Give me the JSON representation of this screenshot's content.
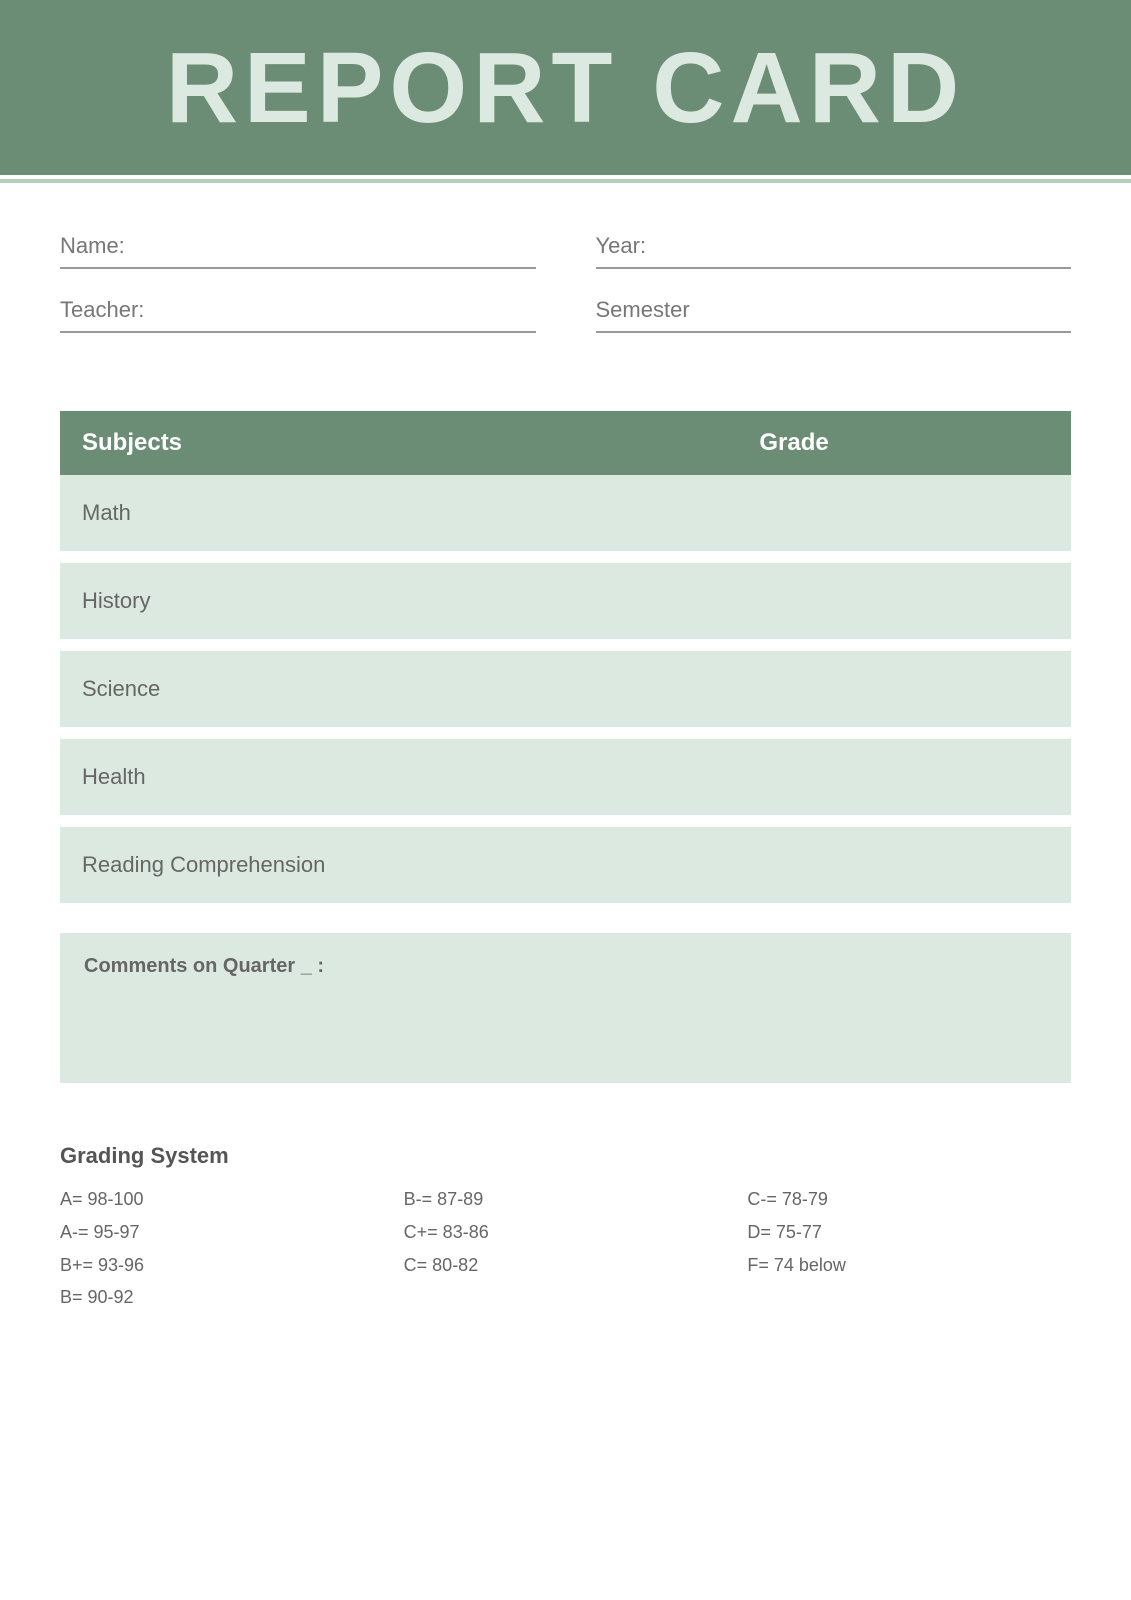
{
  "header": {
    "title": "REPORT CARD"
  },
  "form": {
    "name_label": "Name:",
    "name_value": "",
    "year_label": "Year:",
    "year_value": "",
    "teacher_label": "Teacher:",
    "teacher_value": "",
    "semester_label": "Semester",
    "semester_value": ""
  },
  "table": {
    "subjects_header": "Subjects",
    "grade_header": "Grade",
    "rows": [
      {
        "subject": "Math",
        "grade": ""
      },
      {
        "subject": "History",
        "grade": ""
      },
      {
        "subject": "Science",
        "grade": ""
      },
      {
        "subject": "Health",
        "grade": ""
      },
      {
        "subject": "Reading Comprehension",
        "grade": ""
      }
    ]
  },
  "comments": {
    "label": "Comments on Quarter _ :"
  },
  "grading": {
    "title": "Grading System",
    "col1": [
      "A= 98-100",
      "A-= 95-97",
      "B+= 93-96",
      "B= 90-92"
    ],
    "col2": [
      "B-= 87-89",
      "C+= 83-86",
      "C= 80-82"
    ],
    "col3": [
      "C-= 78-79",
      "D= 75-77",
      "F= 74 below"
    ]
  }
}
